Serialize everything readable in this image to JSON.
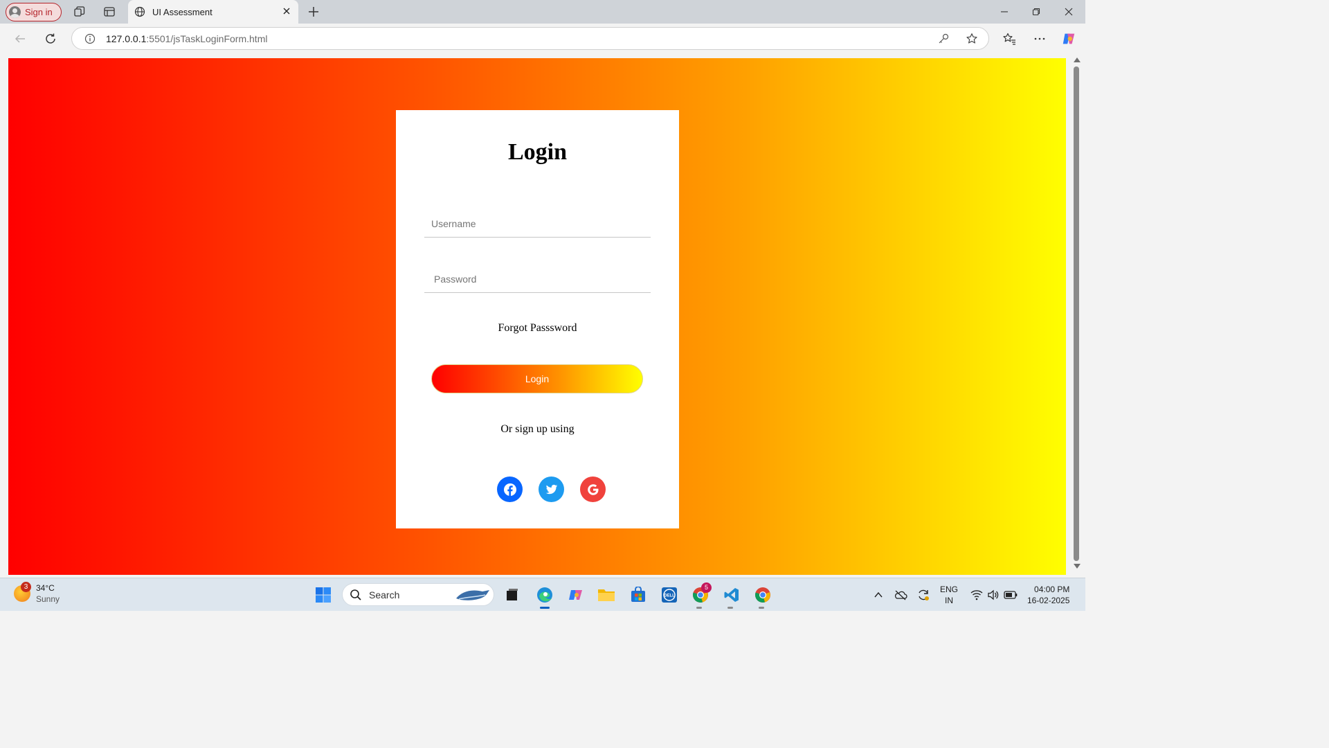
{
  "browser": {
    "signin_label": "Sign in",
    "tab_title": "UI Assessment",
    "url_host": "127.0.0.1",
    "url_rest": ":5501/jsTaskLoginForm.html"
  },
  "page": {
    "background_gradient": [
      "#ff0000",
      "#ff5400",
      "#ffa100",
      "#ffff00"
    ],
    "card": {
      "title": "Login",
      "username_placeholder": "Username",
      "password_placeholder": "Password",
      "forgot_label": "Forgot Passsword",
      "login_button_label": "Login",
      "signup_text": "Or sign up using",
      "social": [
        {
          "name": "facebook-icon",
          "color": "#0866ff"
        },
        {
          "name": "twitter-icon",
          "color": "#1d9bf0"
        },
        {
          "name": "google-icon",
          "color": "#f0423c"
        }
      ]
    }
  },
  "taskbar": {
    "weather_badge": "3",
    "temperature": "34°C",
    "condition": "Sunny",
    "search_label": "Search",
    "chrome_badge": "5",
    "language_line1": "ENG",
    "language_line2": "IN",
    "time": "04:00 PM",
    "date": "16-02-2025"
  }
}
